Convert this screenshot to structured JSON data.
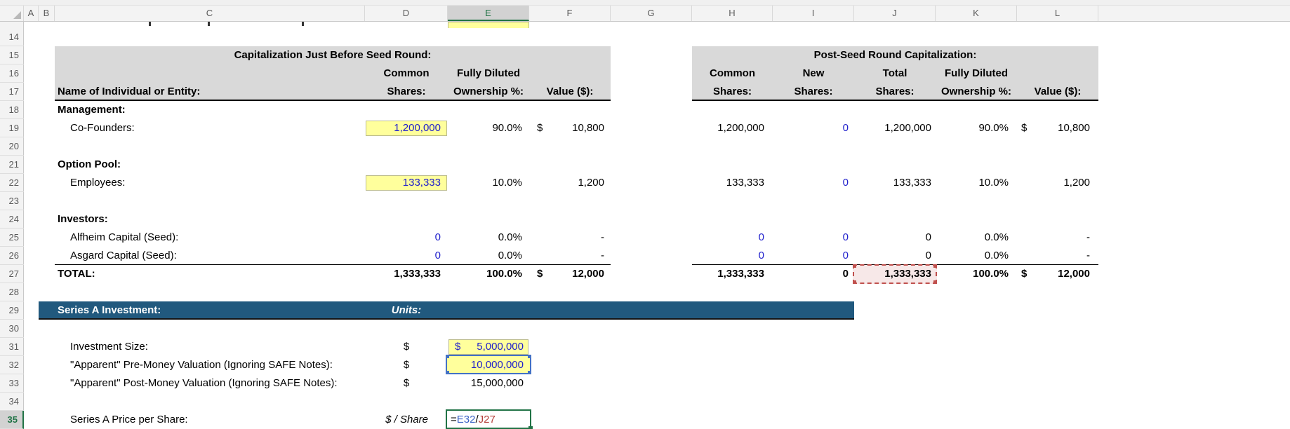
{
  "chrome": {
    "columns": [
      "A",
      "B",
      "C",
      "D",
      "E",
      "F",
      "G",
      "H",
      "I",
      "J",
      "K",
      "L"
    ],
    "rows": [
      "14",
      "15",
      "16",
      "17",
      "18",
      "19",
      "20",
      "21",
      "22",
      "23",
      "24",
      "25",
      "26",
      "27",
      "28",
      "29",
      "30",
      "31",
      "32",
      "33",
      "34",
      "35"
    ],
    "selected_column": "E",
    "active_row": "35"
  },
  "left_table": {
    "title": "Capitalization Just Before Seed Round:",
    "name_header": "Name of Individual or Entity:",
    "headers": {
      "common": "Common",
      "shares": "Shares:",
      "fully_diluted": "Fully Diluted",
      "ownership": "Ownership %:",
      "value": "Value ($):"
    }
  },
  "right_table": {
    "title": "Post-Seed Round Capitalization:",
    "headers": {
      "common": "Common",
      "new": "New",
      "total": "Total",
      "shares": "Shares:",
      "fully_diluted": "Fully Diluted",
      "ownership": "Ownership %:",
      "value": "Value ($):"
    }
  },
  "sections": {
    "management": "Management:",
    "option_pool": "Option Pool:",
    "investors": "Investors:"
  },
  "rows": {
    "co_founders": {
      "label": "Co-Founders:",
      "common_shares": "1,200,000",
      "ownership": "90.0%",
      "value_currency": "$",
      "value": "10,800",
      "post_common": "1,200,000",
      "new_shares": "0",
      "total_shares": "1,200,000",
      "post_ownership": "90.0%",
      "post_value_currency": "$",
      "post_value": "10,800"
    },
    "employees": {
      "label": "Employees:",
      "common_shares": "133,333",
      "ownership": "10.0%",
      "value": "1,200",
      "post_common": "133,333",
      "new_shares": "0",
      "total_shares": "133,333",
      "post_ownership": "10.0%",
      "post_value": "1,200"
    },
    "alfheim": {
      "label": "Alfheim Capital (Seed):",
      "common_shares": "0",
      "ownership": "0.0%",
      "value": "-",
      "post_common": "0",
      "new_shares": "0",
      "total_shares": "0",
      "post_ownership": "0.0%",
      "post_value": "-"
    },
    "asgard": {
      "label": "Asgard Capital (Seed):",
      "common_shares": "0",
      "ownership": "0.0%",
      "value": "-",
      "post_common": "0",
      "new_shares": "0",
      "total_shares": "0",
      "post_ownership": "0.0%",
      "post_value": "-"
    },
    "total": {
      "label": "TOTAL:",
      "common_shares": "1,333,333",
      "ownership": "100.0%",
      "value_currency": "$",
      "value": "12,000",
      "post_common": "1,333,333",
      "new_shares": "0",
      "total_shares": "1,333,333",
      "post_ownership": "100.0%",
      "post_value_currency": "$",
      "post_value": "12,000"
    }
  },
  "series_a": {
    "banner_title": "Series A Investment:",
    "units_header": "Units:",
    "investment_size": {
      "label": "Investment Size:",
      "unit": "$",
      "cell_currency": "$",
      "value": "5,000,000"
    },
    "pre_money": {
      "label": "\"Apparent\" Pre-Money Valuation (Ignoring SAFE Notes):",
      "unit": "$",
      "value": "10,000,000"
    },
    "post_money": {
      "label": "\"Apparent\" Post-Money Valuation (Ignoring SAFE Notes):",
      "unit": "$",
      "value": "15,000,000"
    },
    "price_per_share": {
      "label": "Series A Price per Share:",
      "unit": "$ / Share",
      "formula": {
        "equals": "=",
        "ref1": "E32",
        "divide": "/",
        "ref2": "J27"
      }
    }
  },
  "colors": {
    "accent_green": "#217346",
    "input_blue": "#2020CC",
    "banner_blue": "#21597E",
    "header_band_gray": "#D9D9D9",
    "input_yellow": "#FFFF9C",
    "reference_blue": "#4472C4",
    "reference_red": "#C0504D"
  }
}
